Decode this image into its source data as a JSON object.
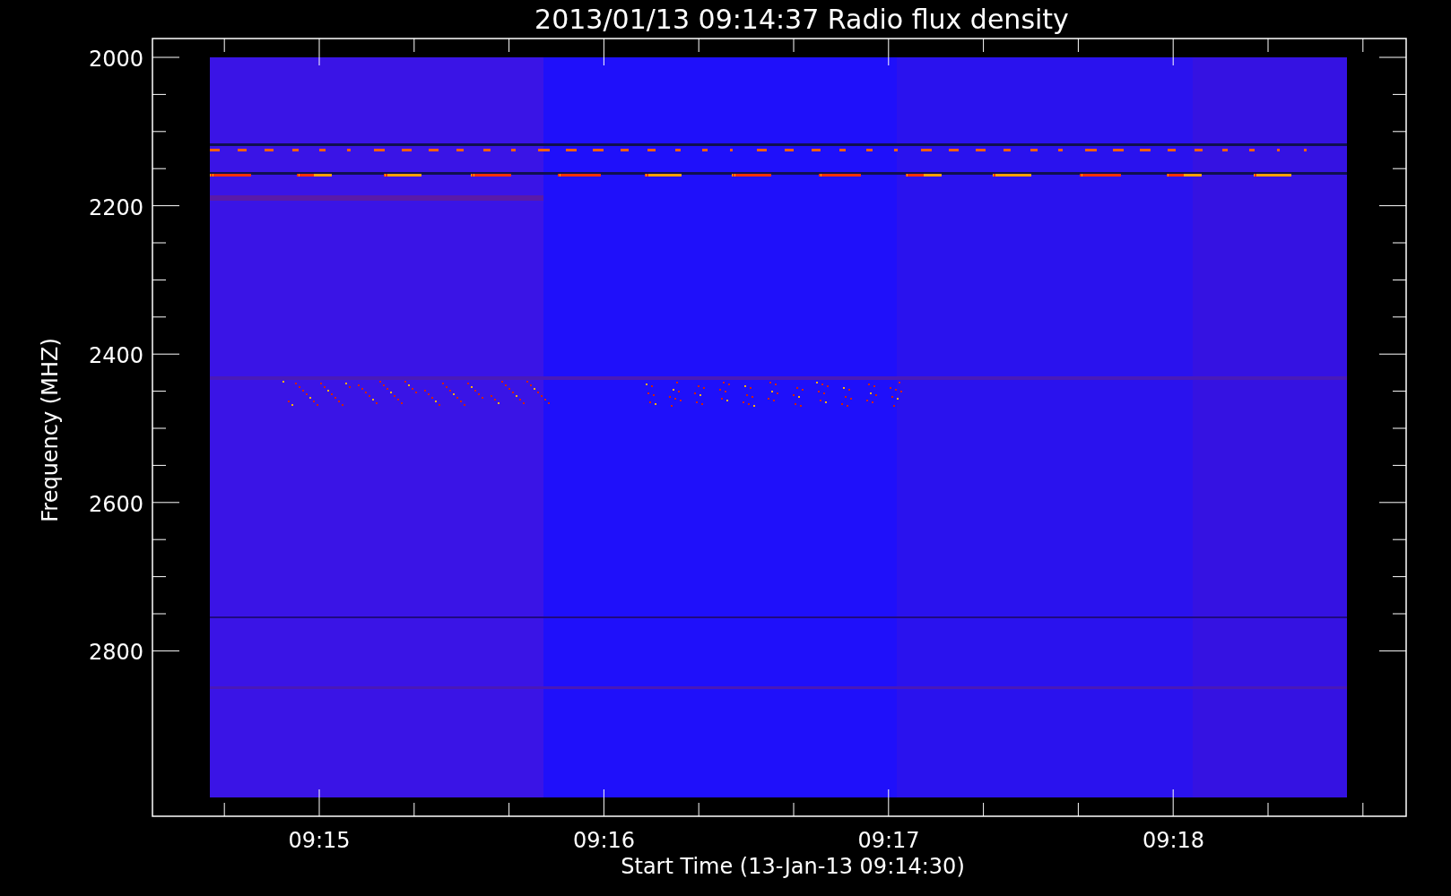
{
  "title": "2013/01/13 09:14:37 Radio flux density",
  "y_axis": {
    "label": "Frequency (MHZ)",
    "ticks": [
      "2000",
      "2200",
      "2400",
      "2600",
      "2800"
    ]
  },
  "x_axis": {
    "label": "Start Time (13-Jan-13 09:14:30)",
    "ticks": [
      "09:15",
      "09:16",
      "09:17",
      "09:18"
    ]
  }
}
